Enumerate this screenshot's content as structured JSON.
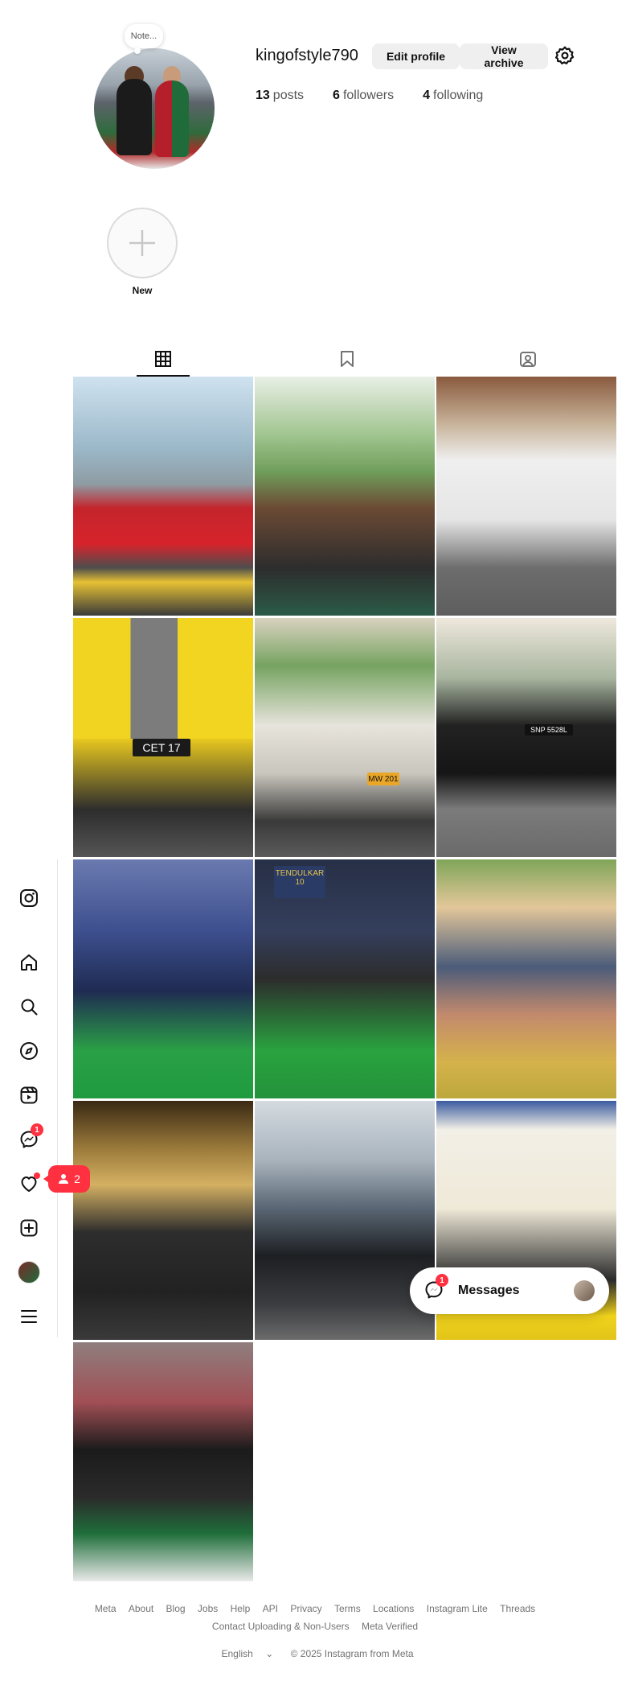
{
  "profile": {
    "note": "Note...",
    "username": "kingofstyle790",
    "edit_button": "Edit profile",
    "archive_button": "View archive",
    "posts_count": "13",
    "posts_label": "posts",
    "followers_count": "6",
    "followers_label": "followers",
    "following_count": "4",
    "following_label": "following"
  },
  "highlight": {
    "new_label": "New"
  },
  "tabs": [
    "posts-grid",
    "saved",
    "tagged"
  ],
  "grid": {
    "tile4_plate": "CET 17",
    "tile5_plate": "MW 201",
    "tile6_plate": "SNP 5528L",
    "tile8_banner": "TENDULKAR 10"
  },
  "nav": {
    "messages_badge": "1",
    "notifications_pill_count": "2"
  },
  "messages_pill": {
    "label": "Messages",
    "badge": "1"
  },
  "footer": {
    "links_row1": [
      "Meta",
      "About",
      "Blog",
      "Jobs",
      "Help",
      "API",
      "Privacy",
      "Terms",
      "Locations",
      "Instagram Lite",
      "Threads"
    ],
    "links_row2": [
      "Contact Uploading & Non-Users",
      "Meta Verified"
    ],
    "language": "English",
    "copyright": "© 2025 Instagram from Meta"
  },
  "colors": {
    "badge": "#ff3040",
    "button_bg": "#efefef",
    "muted_text": "#737373"
  }
}
